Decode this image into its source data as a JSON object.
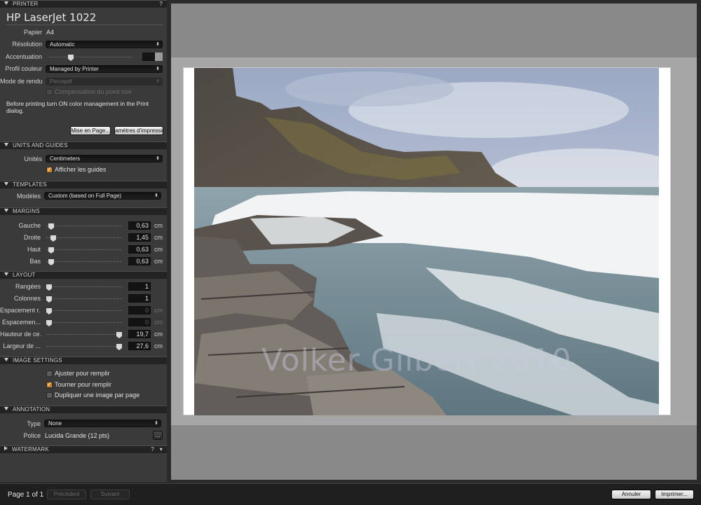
{
  "printer": {
    "section_title": "PRINTER",
    "help": "?",
    "name": "HP LaserJet 1022",
    "paper_label": "Papier",
    "paper_value": "A4",
    "resolution_label": "Résolution",
    "resolution_value": "Automatic",
    "sharpen_label": "Accentuation",
    "color_profile_label": "Profil couleur",
    "color_profile_value": "Managed by Printer",
    "render_mode_label": "Mode de rendu",
    "render_mode_value": "Perceptif",
    "black_point_label": "Compensation du point noir",
    "note": "Before printing turn ON color management in the Print dialog.",
    "page_setup_button": "Mise en Page...",
    "print_settings_button": "amètres d'impressio"
  },
  "units": {
    "section_title": "UNITS AND GUIDES",
    "units_label": "Unités",
    "units_value": "Centimeters",
    "show_guides_label": "Afficher les guides"
  },
  "templates": {
    "section_title": "TEMPLATES",
    "models_label": "Modèles",
    "models_value": "Custom (based on Full Page)"
  },
  "margins": {
    "section_title": "MARGINS",
    "unit": "cm",
    "rows": [
      {
        "label": "Gauche",
        "value": "0,63",
        "level": 0.03
      },
      {
        "label": "Droite",
        "value": "1,45",
        "level": 0.06
      },
      {
        "label": "Haut",
        "value": "0,63",
        "level": 0.03
      },
      {
        "label": "Bas",
        "value": "0,63",
        "level": 0.03
      }
    ]
  },
  "layout": {
    "section_title": "LAYOUT",
    "unit": "cm",
    "rows": [
      {
        "label": "Rangées",
        "value": "1",
        "level": 0.0,
        "unit": ""
      },
      {
        "label": "Colonnes",
        "value": "1",
        "level": 0.0,
        "unit": ""
      },
      {
        "label": "Espacement r...",
        "value": "0",
        "level": 0.0,
        "unit": "cm"
      },
      {
        "label": "Espacemen...",
        "value": "0",
        "level": 0.0,
        "unit": "cm"
      },
      {
        "label": "Hauteur de ce...",
        "value": "19,7",
        "level": 1.0,
        "unit": "cm"
      },
      {
        "label": "Largeur de ...",
        "value": "27,6",
        "level": 1.0,
        "unit": "cm"
      }
    ]
  },
  "image_settings": {
    "section_title": "IMAGE SETTINGS",
    "fit_label": "Ajuster pour remplir",
    "rotate_label": "Tourner pour remplir",
    "duplicate_label": "Dupliquer une image par page"
  },
  "annotation": {
    "section_title": "ANNOTATION",
    "type_label": "Type",
    "type_value": "None",
    "font_label": "Police",
    "font_value": "Lucida Grande (12 pts)",
    "font_button": "..."
  },
  "watermark": {
    "section_title": "WATERMARK",
    "help": "?"
  },
  "preview": {
    "watermark_text": "Volker Gilbert 2010"
  },
  "bottombar": {
    "page_indicator": "Page 1 of 1",
    "previous_label": "Précédent",
    "next_label": "Suivant",
    "cancel_label": "Annuler",
    "print_label": "Imprimer..."
  },
  "colors": {
    "panel_bg": "#3a3a3a",
    "section_header_bg": "#232323",
    "checkbox_accent": "#d28a2a",
    "preview_bg": "#898989"
  }
}
